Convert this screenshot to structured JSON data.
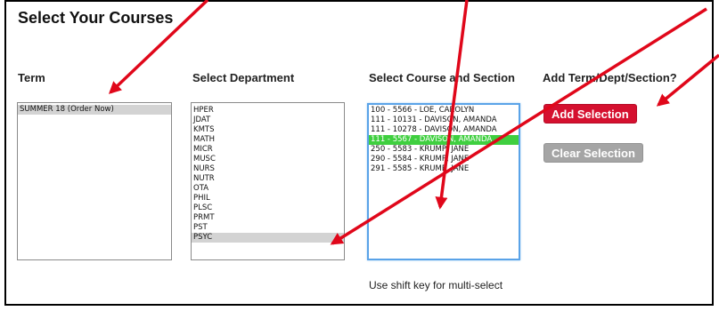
{
  "title": "Select Your Courses",
  "columns": {
    "term_label": "Term",
    "department_label": "Select Department",
    "course_label": "Select Course and Section",
    "add_label": "Add Term/Dept/Section?"
  },
  "term_list": {
    "options": [
      "SUMMER 18 (Order Now)"
    ],
    "selected_index": 0
  },
  "department_list": {
    "options": [
      "HPER",
      "JDAT",
      "KMTS",
      "MATH",
      "MICR",
      "MUSC",
      "NURS",
      "NUTR",
      "OTA",
      "PHIL",
      "PLSC",
      "PRMT",
      "PST",
      "PSYC"
    ],
    "selected_index": 13
  },
  "course_list": {
    "options": [
      "100 - 5566 - LOE, CAROLYN",
      "111 - 10131 - DAVISON, AMANDA",
      "111 - 10278 - DAVISON, AMANDA",
      "111 - 5567 - DAVISON, AMANDA",
      "250 - 5583 - KRUMP, JANE",
      "290 - 5584 - KRUMP, JANE",
      "291 - 5585 - KRUMP, JANE"
    ],
    "selected_index": 3
  },
  "buttons": {
    "add_selection": "Add Selection",
    "clear_selection": "Clear Selection"
  },
  "hint": "Use shift key for multi-select",
  "colors": {
    "arrow": "#e0071a",
    "add_button": "#d5102f",
    "clear_button": "#a5a5a5",
    "selected_course": "#3fcf3f",
    "selected_gray": "#d3d3d3",
    "focus_border": "#5aa3e8"
  }
}
